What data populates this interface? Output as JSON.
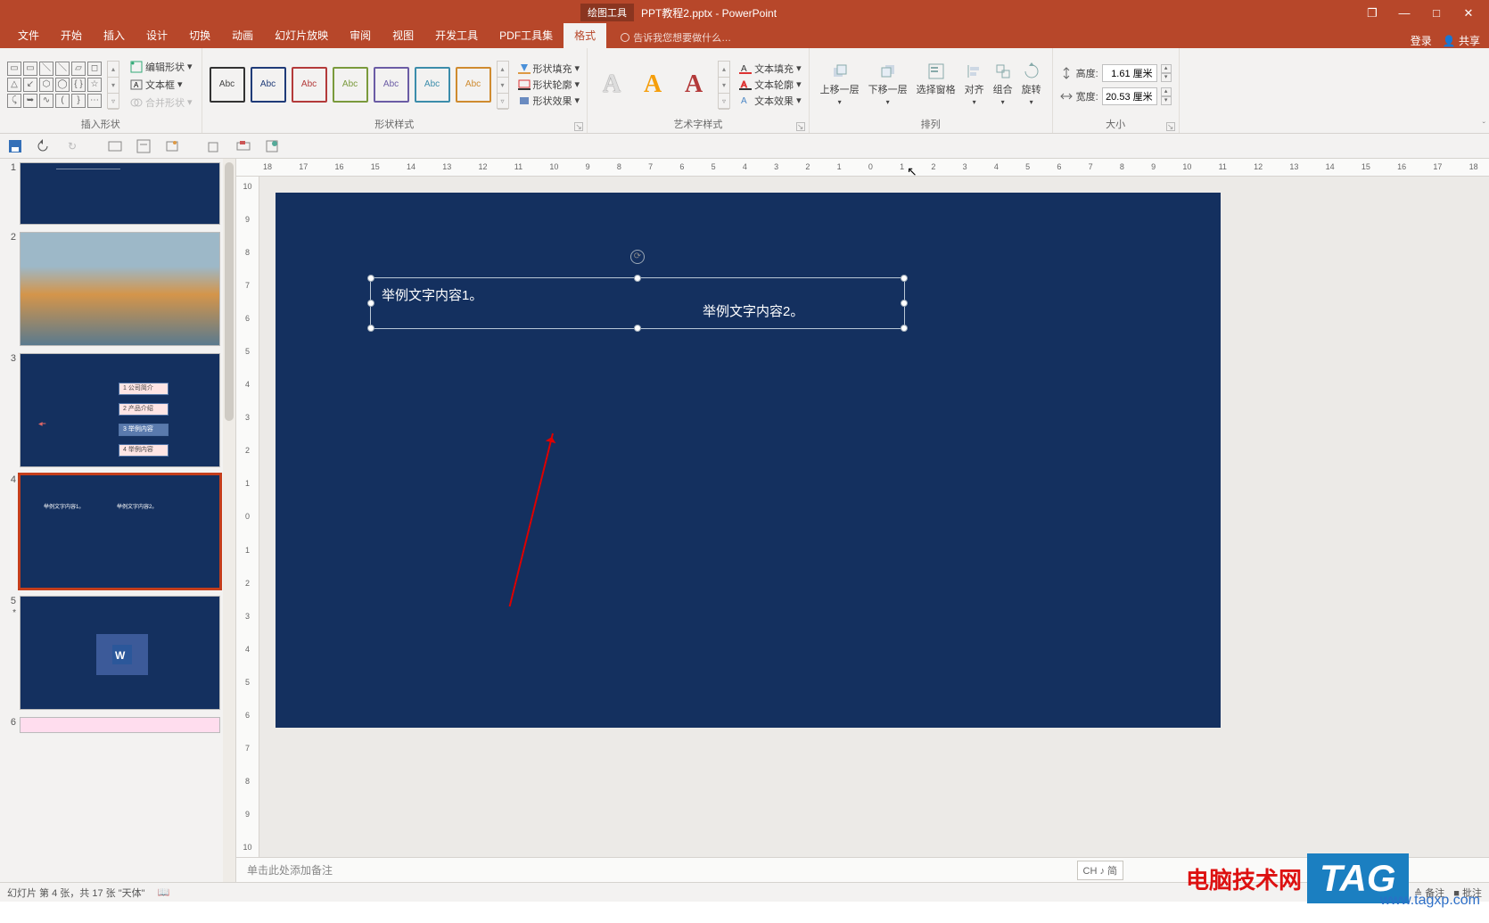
{
  "title": {
    "tool_context": "绘图工具",
    "filename": "PPT教程2.pptx - PowerPoint"
  },
  "window_controls": {
    "restore_down_icon": "❐",
    "minimize": "—",
    "maximize": "□",
    "close": "✕"
  },
  "tabs": {
    "items": [
      "文件",
      "开始",
      "插入",
      "设计",
      "切换",
      "动画",
      "幻灯片放映",
      "审阅",
      "视图",
      "开发工具",
      "PDF工具集",
      "格式"
    ],
    "active_index": 11,
    "tell_me": "告诉我您想要做什么…"
  },
  "account": {
    "login": "登录",
    "share": "共享"
  },
  "ribbon": {
    "insert_shapes": {
      "edit_shape": "编辑形状",
      "text_box": "文本框",
      "merge_shapes": "合并形状",
      "group_label": "插入形状"
    },
    "shape_styles": {
      "sample": "Abc",
      "fill": "形状填充",
      "outline": "形状轮廓",
      "effects": "形状效果",
      "group_label": "形状样式"
    },
    "wordart": {
      "fill": "文本填充",
      "outline": "文本轮廓",
      "effects": "文本效果",
      "group_label": "艺术字样式",
      "sample": "A"
    },
    "arrange": {
      "bring_fwd": "上移一层",
      "send_back": "下移一层",
      "selection": "选择窗格",
      "align": "对齐",
      "group": "组合",
      "rotate": "旋转",
      "group_label": "排列"
    },
    "size": {
      "height_lbl": "高度:",
      "width_lbl": "宽度:",
      "height_val": "1.61 厘米",
      "width_val": "20.53 厘米",
      "group_label": "大小"
    }
  },
  "ruler_marks": [
    "18",
    "17",
    "16",
    "15",
    "14",
    "13",
    "12",
    "11",
    "10",
    "9",
    "8",
    "7",
    "6",
    "5",
    "4",
    "3",
    "2",
    "1",
    "0",
    "1",
    "2",
    "3",
    "4",
    "5",
    "6",
    "7",
    "8",
    "9",
    "10",
    "11",
    "12",
    "13",
    "14",
    "15",
    "16",
    "17",
    "18"
  ],
  "ruler_v": [
    "10",
    "9",
    "8",
    "7",
    "6",
    "5",
    "4",
    "3",
    "2",
    "1",
    "0",
    "1",
    "2",
    "3",
    "4",
    "5",
    "6",
    "7",
    "8",
    "9",
    "10"
  ],
  "slide": {
    "text1": "举例文字内容1。",
    "text2": "举例文字内容2。"
  },
  "thumbnails": {
    "numbers": [
      "1",
      "2",
      "3",
      "4",
      "5",
      "6"
    ],
    "star": "*",
    "menu_items": [
      "1 公司简介",
      "2 产品介绍",
      "3 举例内容",
      "4 举例内容"
    ]
  },
  "notes": {
    "placeholder": "单击此处添加备注"
  },
  "ime": {
    "label": "CH ♪ 简"
  },
  "status": {
    "left": "幻灯片 第 4 张，共 17 张    \"天体\"",
    "notes_btn": "≙ 备注",
    "comments_btn": "■ 批注"
  },
  "watermark": {
    "brand": "电脑技术网",
    "tag": "TAG",
    "url": "www.tagxp.com"
  }
}
